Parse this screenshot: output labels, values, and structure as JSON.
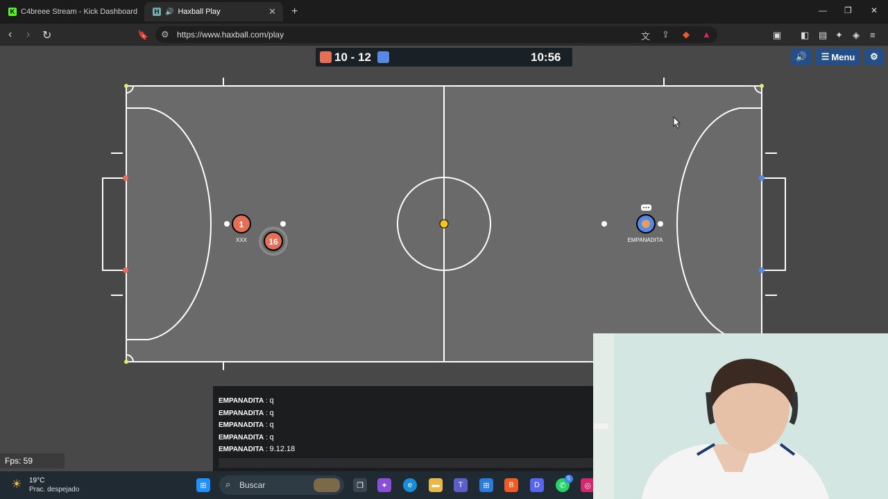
{
  "browser": {
    "tabs": [
      {
        "title": "C4breee Stream - Kick Dashboard",
        "icon": "kick-icon"
      },
      {
        "title": "Haxball Play",
        "icon": "haxball-icon"
      }
    ],
    "url": "https://www.haxball.com/play"
  },
  "game": {
    "score": "10 - 12",
    "timer": "10:56",
    "red_color": "#e56e56",
    "blue_color": "#5689e5",
    "menu_label": "Menu",
    "players": [
      {
        "number": "1",
        "name": "XXX",
        "team": "red"
      },
      {
        "number": "16",
        "name": "",
        "team": "red"
      },
      {
        "number": "",
        "name": "EMPANADITA",
        "team": "blue"
      }
    ]
  },
  "chat": {
    "messages": [
      {
        "author": "EMPANADITA",
        "text": "q"
      },
      {
        "author": "EMPANADITA",
        "text": "q"
      },
      {
        "author": "EMPANADITA",
        "text": "q"
      },
      {
        "author": "EMPANADITA",
        "text": "q"
      },
      {
        "author": "EMPANADITA",
        "text": "9.12.18"
      }
    ]
  },
  "fps": "Fps: 59",
  "taskbar": {
    "temperature": "19°C",
    "weather": "Prac. despejado",
    "search_placeholder": "Buscar",
    "whatsapp_badge": "5"
  }
}
